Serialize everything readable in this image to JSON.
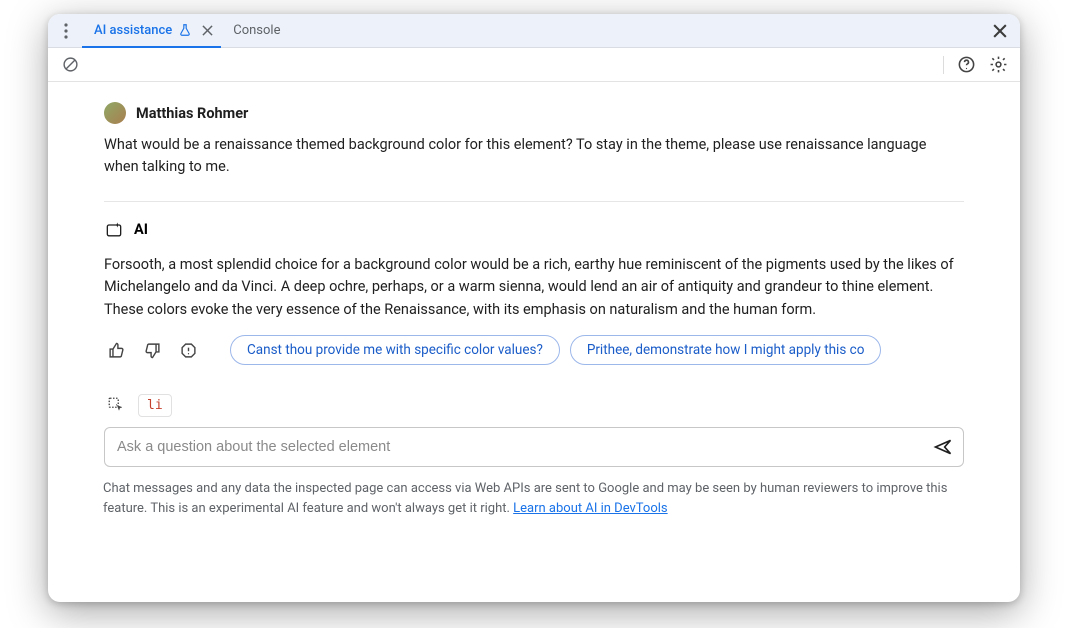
{
  "tabs": {
    "ai": "AI assistance",
    "console": "Console"
  },
  "user": {
    "name": "Matthias Rohmer",
    "message": "What would be a renaissance themed background color for this element? To stay in the theme, please use renaissance language when talking to me."
  },
  "ai": {
    "label": "AI",
    "message": "Forsooth, a most splendid choice for a background color would be a rich, earthy hue reminiscent of the pigments used by the likes of Michelangelo and da Vinci. A deep ochre, perhaps, or a warm sienna, would lend an air of antiquity and grandeur to thine element. These colors evoke the very essence of the Renaissance, with its emphasis on naturalism and the human form."
  },
  "suggestions": [
    "Canst thou provide me with specific color values?",
    "Prithee, demonstrate how I might apply this co"
  ],
  "element": {
    "tag": "li"
  },
  "input": {
    "placeholder": "Ask a question about the selected element"
  },
  "disclaimer": {
    "text": "Chat messages and any data the inspected page can access via Web APIs are sent to Google and may be seen by human reviewers to improve this feature. This is an experimental AI feature and won't always get it right. ",
    "link": "Learn about AI in DevTools"
  }
}
